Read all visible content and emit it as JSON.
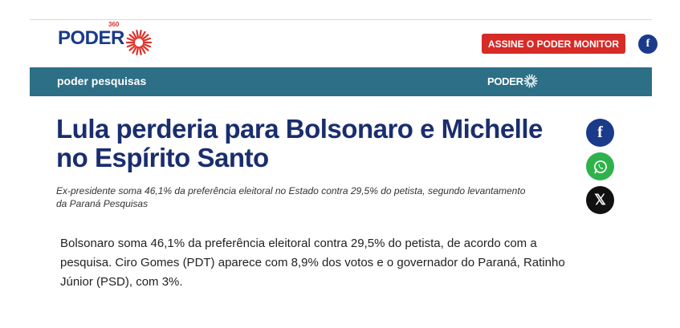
{
  "header": {
    "logo_text": "PODER",
    "logo_suffix": "360",
    "subscribe_label": "ASSINE O PODER MONITOR",
    "facebook_icon": "f"
  },
  "section_band": {
    "label": "poder pesquisas",
    "logo_text": "PODER"
  },
  "article": {
    "headline": "Lula perderia para Bolsonaro e Michelle no Espírito Santo",
    "subtitle": "Ex-presidente soma 46,1% da preferência eleitoral no Estado contra 29,5% do petista, segundo levantamento da Paraná Pesquisas",
    "body": "Bolsonaro soma 46,1% da preferência eleitoral contra 29,5% do petista, de acordo com a pesquisa. Ciro Gomes (PDT) aparece com 8,9% dos votos e o governador do Paraná, Ratinho Júnior (PSD), com 3%."
  },
  "share": {
    "facebook_glyph": "f",
    "x_glyph": "𝕏"
  },
  "colors": {
    "brand_blue": "#1a3a8a",
    "brand_red": "#d62b27",
    "band_teal": "#2d6f86",
    "whatsapp_green": "#2fb24c"
  }
}
